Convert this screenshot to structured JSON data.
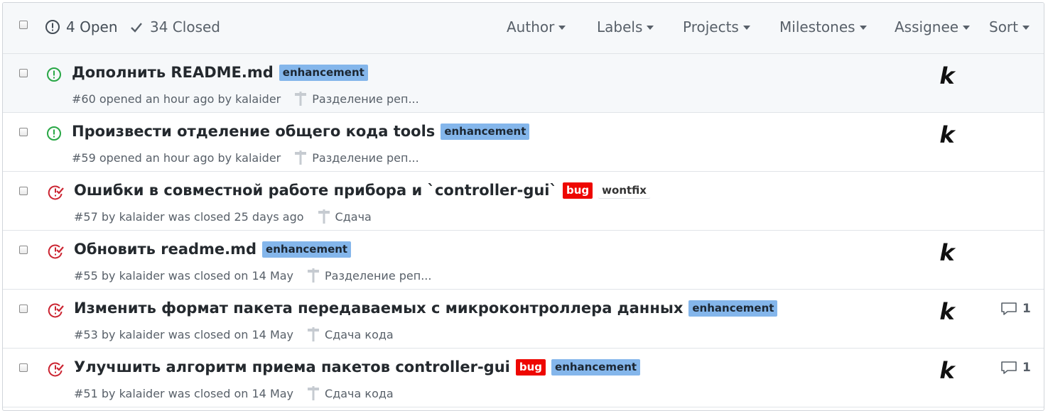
{
  "header": {
    "open_label": "4 Open",
    "closed_label": "34 Closed",
    "filters": [
      "Author",
      "Labels",
      "Projects",
      "Milestones",
      "Assignee",
      "Sort"
    ]
  },
  "issues": [
    {
      "title": "Дополнить README.md",
      "state": "open",
      "labels": [
        {
          "name": "enhancement",
          "color": "#84b6eb"
        }
      ],
      "meta": "#60 opened an hour ago by kalaider",
      "milestone": "Разделение реп...",
      "assignee": "k",
      "comments": ""
    },
    {
      "title": "Произвести отделение общего кода tools",
      "state": "open",
      "labels": [
        {
          "name": "enhancement",
          "color": "#84b6eb"
        }
      ],
      "meta": "#59 opened an hour ago by kalaider",
      "milestone": "Разделение реп...",
      "assignee": "k",
      "comments": ""
    },
    {
      "title": "Ошибки в совместной работе прибора и `controller-gui`",
      "state": "closed",
      "labels": [
        {
          "name": "bug",
          "color": "#ee0701"
        },
        {
          "name": "wontfix",
          "color": "#ffffff"
        }
      ],
      "meta": "#57 by kalaider was closed 25 days ago",
      "milestone": "Сдача",
      "assignee": "",
      "comments": ""
    },
    {
      "title": "Обновить readme.md",
      "state": "closed",
      "labels": [
        {
          "name": "enhancement",
          "color": "#84b6eb"
        }
      ],
      "meta": "#55 by kalaider was closed on 14 May",
      "milestone": "Разделение реп...",
      "assignee": "k",
      "comments": ""
    },
    {
      "title": "Изменить формат пакета передаваемых с микроконтроллера данных",
      "state": "closed",
      "labels": [
        {
          "name": "enhancement",
          "color": "#84b6eb"
        }
      ],
      "meta": "#53 by kalaider was closed on 14 May",
      "milestone": "Сдача кода",
      "assignee": "k",
      "comments": "1"
    },
    {
      "title": "Улучшить алгоритм приема пакетов controller-gui",
      "state": "closed",
      "labels": [
        {
          "name": "bug",
          "color": "#ee0701"
        },
        {
          "name": "enhancement",
          "color": "#84b6eb"
        }
      ],
      "meta": "#51 by kalaider was closed on 14 May",
      "milestone": "Сдача кода",
      "assignee": "k",
      "comments": "1"
    }
  ],
  "colors": {
    "open_icon": "#28a745",
    "closed_icon": "#cb2431",
    "enhancement": "#84b6eb",
    "bug": "#ee0701"
  },
  "icons": {
    "open": "issue-opened-icon",
    "closed": "issue-closed-icon",
    "milestone": "milestone-icon",
    "comment": "comment-icon",
    "check": "check-icon"
  }
}
